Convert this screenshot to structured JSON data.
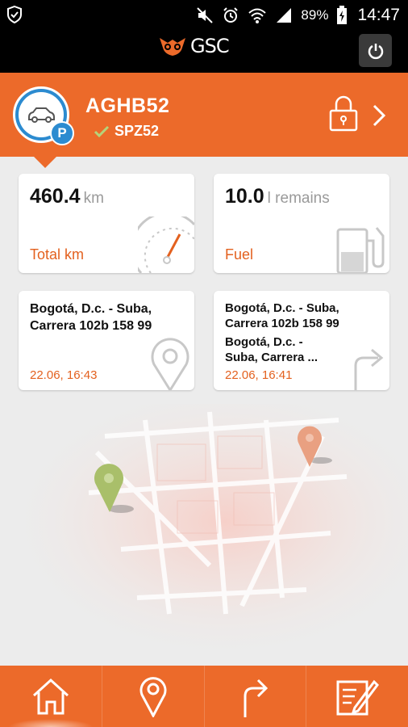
{
  "status_bar": {
    "battery": "89%",
    "time": "14:47"
  },
  "app": {
    "brand": "GSC"
  },
  "vehicle": {
    "plate": "AGHB52",
    "subplate": "SPZ52",
    "parking_badge": "P"
  },
  "cards": {
    "total_km": {
      "value": "460.4",
      "unit": "km",
      "caption": "Total km"
    },
    "fuel": {
      "value": "10.0",
      "unit": "l remains",
      "caption": "Fuel"
    },
    "location": {
      "address_line1": "Bogotá, D.c. - Suba,",
      "address_line2": "Carrera 102b 158 99",
      "time": "22.06, 16:43"
    },
    "trip": {
      "from_line1": "Bogotá, D.c. - Suba,",
      "from_line2": "Carrera 102b 158 99",
      "to_line1": "Bogotá, D.c. -",
      "to_line2": "Suba, Carrera ...",
      "time": "22.06, 16:41"
    }
  },
  "colors": {
    "accent": "#ec6a2a",
    "accent_text": "#e3611f",
    "badge_blue": "#2c8bd0",
    "pin_green": "#a9bf6a",
    "pin_orange": "#e9a081"
  },
  "nav": [
    "home-icon",
    "location-pin-icon",
    "turn-arrow-icon",
    "edit-notes-icon"
  ]
}
